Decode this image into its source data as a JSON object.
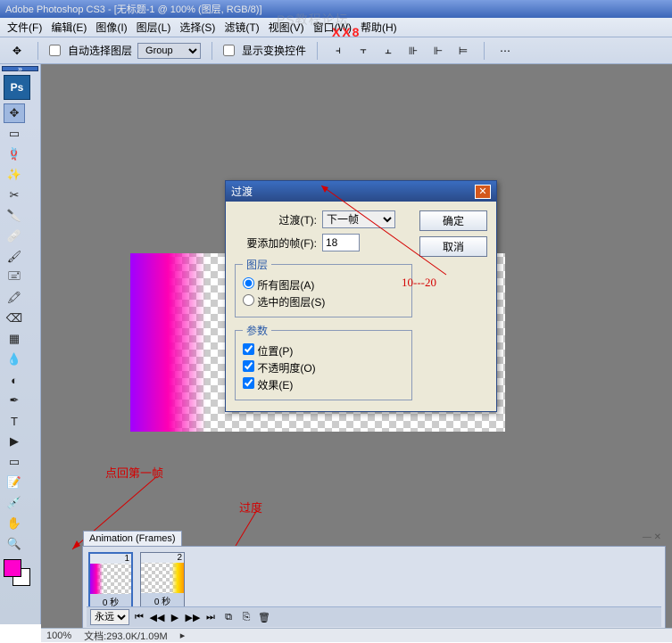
{
  "titlebar": "Adobe Photoshop CS3 - [无标题-1 @ 100% (图层, RGB/8)]",
  "menus": [
    "文件(F)",
    "编辑(E)",
    "图像(I)",
    "图层(L)",
    "选择(S)",
    "滤镜(T)",
    "视图(V)",
    "窗口(W)",
    "帮助(H)"
  ],
  "options": {
    "auto_select": "自动选择图层",
    "group": "Group",
    "show_transform": "显示变换控件"
  },
  "dialog": {
    "title": "过渡",
    "transition_label": "过渡(T):",
    "transition_value": "下一帧",
    "frames_label": "要添加的帧(F):",
    "frames_value": "18",
    "ok": "确定",
    "cancel": "取消",
    "layers_legend": "图层",
    "all_layers": "所有图层(A)",
    "selected_layers": "选中的图层(S)",
    "params_legend": "参数",
    "position": "位置(P)",
    "opacity": "不透明度(O)",
    "effects": "效果(E)"
  },
  "annotations": {
    "range": "10---20",
    "back_to_first": "点回第一帧",
    "tween": "过度"
  },
  "animation": {
    "panel_title": "Animation (Frames)",
    "frame1_num": "1",
    "frame1_time": "0 秒",
    "frame2_num": "2",
    "frame2_time": "0 秒",
    "loop": "永远"
  },
  "status": {
    "zoom": "100%",
    "docinfo": "文档:293.0K/1.09M"
  },
  "watermark": "PS教程论坛",
  "red_x": "XX8"
}
